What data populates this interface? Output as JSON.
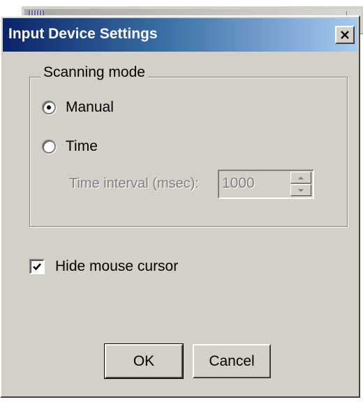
{
  "dialog": {
    "title": "Input Device Settings",
    "close_glyph": "✕"
  },
  "scanning_mode": {
    "legend": "Scanning mode",
    "options": [
      {
        "label": "Manual",
        "selected": true
      },
      {
        "label": "Time",
        "selected": false
      }
    ],
    "interval_label": "Time interval (msec):",
    "interval_value": "1000",
    "interval_enabled": false
  },
  "hide_cursor": {
    "label": "Hide mouse cursor",
    "checked": true
  },
  "buttons": {
    "ok_label": "OK",
    "cancel_label": "Cancel"
  },
  "colors": {
    "face": "#d4d0c8",
    "title_start": "#0a246a",
    "title_end": "#a6caf0",
    "disabled_text": "#808080"
  }
}
